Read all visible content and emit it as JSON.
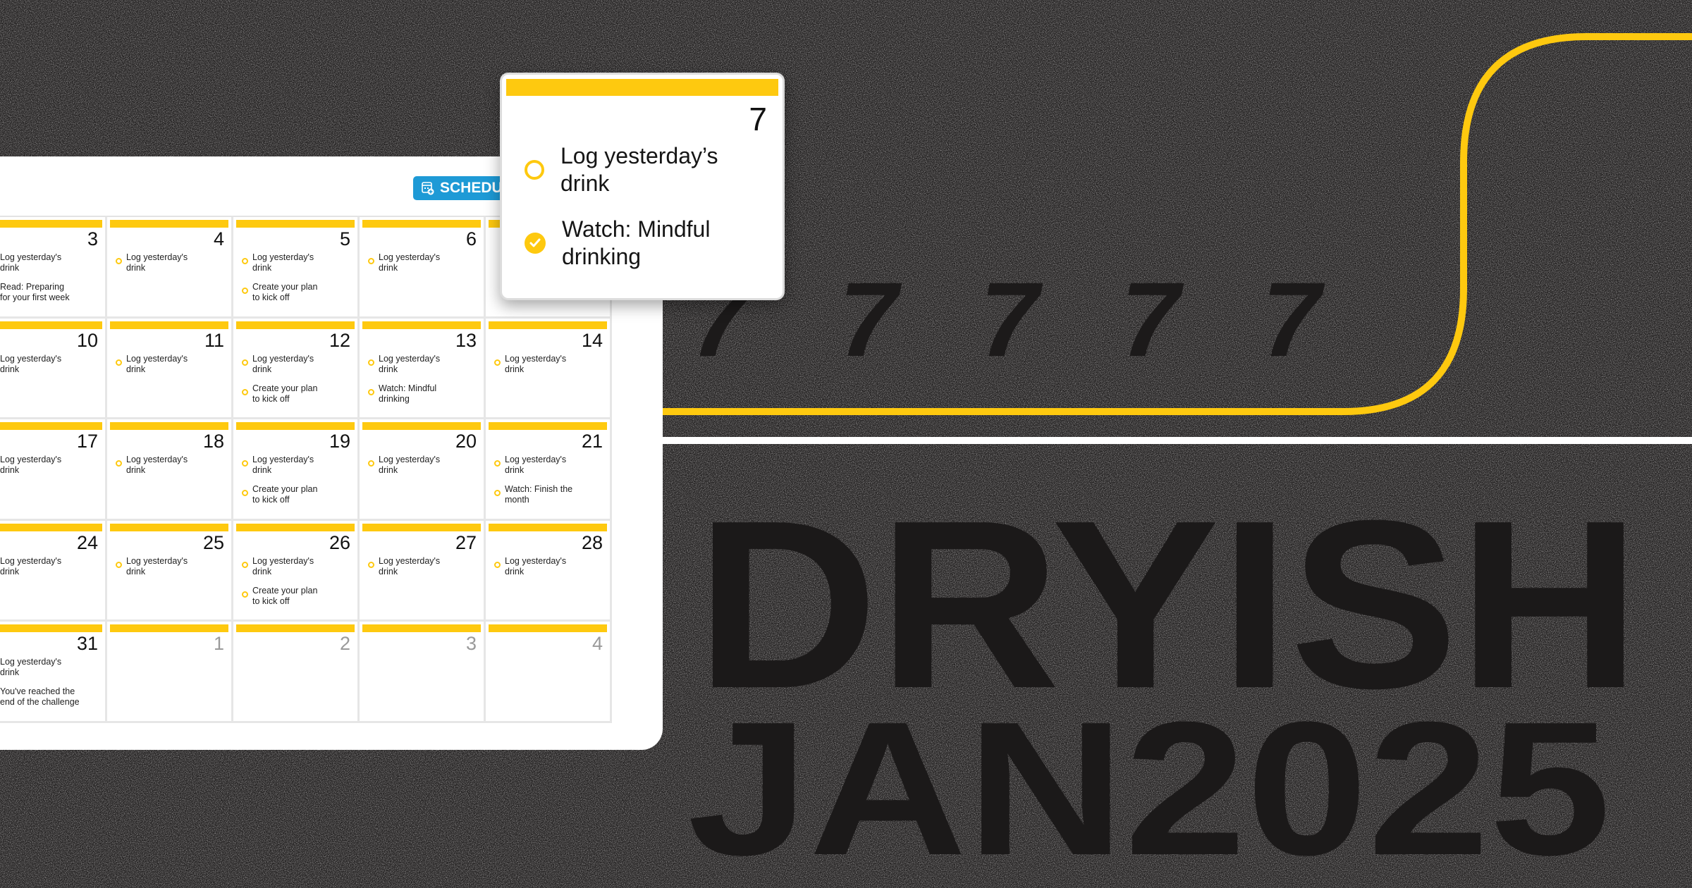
{
  "colors": {
    "accent": "#fec90f",
    "button": "#1e9ad6",
    "background": "#2a2828"
  },
  "header": {
    "schedule_button": "SCHEDULE",
    "schedule_icon": "calendar-add-icon"
  },
  "calendar": {
    "rows": [
      [
        {
          "day": "3",
          "tasks": [
            "Log yesterday's\ndrink",
            "Read: Preparing\nfor your first week"
          ]
        },
        {
          "day": "4",
          "tasks": [
            "Log yesterday's\ndrink"
          ]
        },
        {
          "day": "5",
          "tasks": [
            "Log yesterday's\ndrink",
            "Create your plan\nto kick off"
          ]
        },
        {
          "day": "6",
          "tasks": [
            "Log yesterday's\ndrink"
          ]
        },
        {
          "day": "7",
          "tasks": []
        }
      ],
      [
        {
          "day": "10",
          "tasks": [
            "Log yesterday's\ndrink"
          ]
        },
        {
          "day": "11",
          "tasks": [
            "Log yesterday's\ndrink"
          ]
        },
        {
          "day": "12",
          "tasks": [
            "Log yesterday's\ndrink",
            "Create your plan\nto kick off"
          ]
        },
        {
          "day": "13",
          "tasks": [
            "Log yesterday's\ndrink",
            "Watch: Mindful\ndrinking"
          ]
        },
        {
          "day": "14",
          "tasks": [
            "Log yesterday's\ndrink"
          ]
        }
      ],
      [
        {
          "day": "17",
          "tasks": [
            "Log yesterday's\ndrink"
          ]
        },
        {
          "day": "18",
          "tasks": [
            "Log yesterday's\ndrink"
          ]
        },
        {
          "day": "19",
          "tasks": [
            "Log yesterday's\ndrink",
            "Create your plan\nto kick off"
          ]
        },
        {
          "day": "20",
          "tasks": [
            "Log yesterday's\ndrink"
          ]
        },
        {
          "day": "21",
          "tasks": [
            "Log yesterday's\ndrink",
            "Watch: Finish the\nmonth"
          ]
        }
      ],
      [
        {
          "day": "24",
          "tasks": [
            "Log yesterday's\ndrink"
          ]
        },
        {
          "day": "25",
          "tasks": [
            "Log yesterday's\ndrink"
          ]
        },
        {
          "day": "26",
          "tasks": [
            "Log yesterday's\ndrink",
            "Create your plan\nto kick off"
          ]
        },
        {
          "day": "27",
          "tasks": [
            "Log yesterday's\ndrink"
          ]
        },
        {
          "day": "28",
          "tasks": [
            "Log yesterday's\ndrink"
          ]
        }
      ],
      [
        {
          "day": "31",
          "tasks": [
            "Log yesterday's\ndrink",
            "You've reached the\nend of the challenge"
          ]
        },
        {
          "day": "1",
          "muted": true,
          "tasks": []
        },
        {
          "day": "2",
          "muted": true,
          "tasks": []
        },
        {
          "day": "3",
          "muted": true,
          "tasks": []
        },
        {
          "day": "4",
          "muted": true,
          "tasks": []
        }
      ]
    ]
  },
  "popup": {
    "day": "7",
    "tasks": [
      {
        "text": "Log yesterday’s\ndrink",
        "done": false
      },
      {
        "text": "Watch: Mindful\ndrinking",
        "done": true
      }
    ]
  },
  "backdrop": {
    "line1": "DRYISH",
    "line2": "JAN2025",
    "ghost_glyph": "7"
  }
}
